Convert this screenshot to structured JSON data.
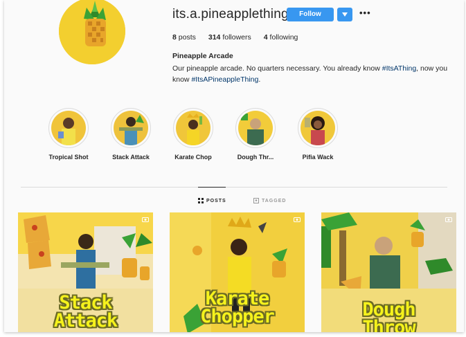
{
  "profile": {
    "username": "its.a.pineapplething",
    "follow_label": "Follow",
    "more_label": "•••",
    "stats": {
      "posts_count": "8",
      "posts_label": "posts",
      "followers_count": "314",
      "followers_label": "followers",
      "following_count": "4",
      "following_label": "following"
    },
    "bio_name": "Pineapple Arcade",
    "bio_text_1": "Our pineapple arcade. No quarters necessary. You already know ",
    "bio_tag_1": "#ItsAThing",
    "bio_text_2": ", now you know ",
    "bio_tag_2": "#ItsAPineappleThing",
    "bio_text_3": "."
  },
  "highlights": [
    {
      "label": "Tropical Shot"
    },
    {
      "label": "Stack Attack"
    },
    {
      "label": "Karate Chop"
    },
    {
      "label": "Dough Thr..."
    },
    {
      "label": "Pifia Wack"
    }
  ],
  "tabs": {
    "posts": "POSTS",
    "tagged": "TAGGED"
  },
  "posts": [
    {
      "title_line1": "Stack",
      "title_line2": "Attack"
    },
    {
      "title_line1": "Karate",
      "title_line2": "Chopper"
    },
    {
      "title_line1": "Dough",
      "title_line2": "Throw"
    }
  ],
  "colors": {
    "accent": "#3897f0",
    "hashtag": "#003569",
    "brand_yellow": "#f2c92a",
    "post_title": "#f5f21c"
  }
}
